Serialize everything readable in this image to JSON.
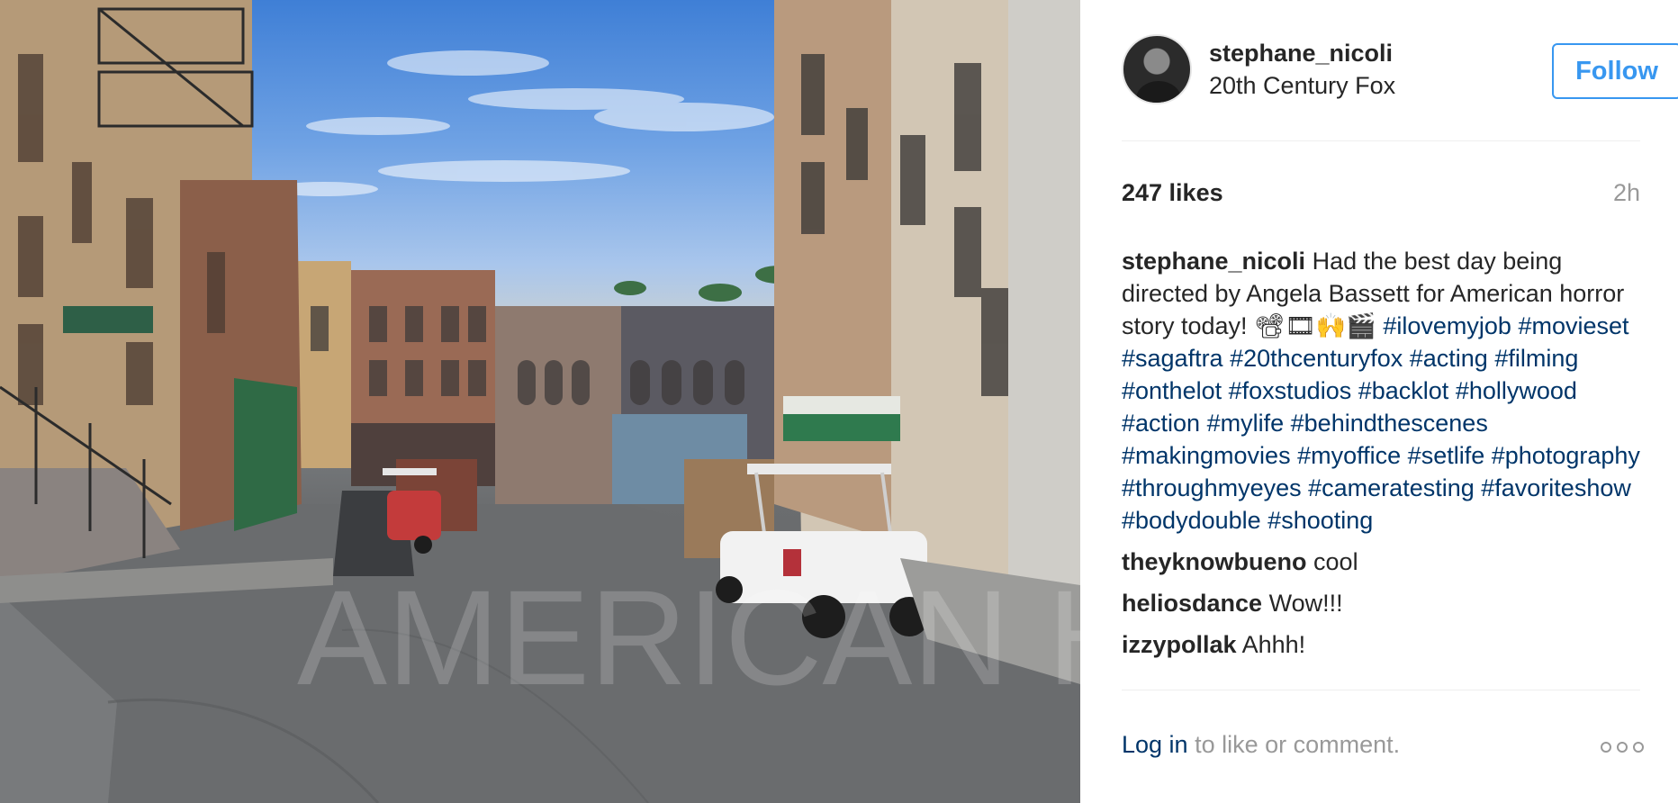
{
  "post": {
    "image_alt": "Empty studio backlot street with brick buildings, parked golf cart and dumpsters",
    "watermark": "AMERICAN HORROR STORY BRAS"
  },
  "header": {
    "username": "stephane_nicoli",
    "location": "20th Century Fox",
    "follow_label": "Follow"
  },
  "stats": {
    "likes": "247 likes",
    "time": "2h"
  },
  "caption": {
    "author": "stephane_nicoli",
    "text": "Had the best day being directed by Angela Bassett for American horror story today! 📽🎞🙌🎬",
    "hashtags": [
      "#ilovemyjob",
      "#movieset",
      "#sagaftra",
      "#20thcenturyfox",
      "#acting",
      "#filming",
      "#onthelot",
      "#foxstudios",
      "#backlot",
      "#hollywood",
      "#action",
      "#mylife",
      "#behindthescenes",
      "#makingmovies",
      "#myoffice",
      "#setlife",
      "#photography",
      "#throughmyeyes",
      "#cameratesting",
      "#favoriteshow",
      "#bodydouble",
      "#shooting"
    ]
  },
  "comments": [
    {
      "author": "theyknowbueno",
      "text": "cool"
    },
    {
      "author": "heliosdance",
      "text": "Wow!!!"
    },
    {
      "author": "izzypollak",
      "text": "Ahhh!"
    }
  ],
  "footer": {
    "login_link": "Log in",
    "login_text": " to like or comment."
  },
  "colors": {
    "link_blue": "#003569",
    "follow_blue": "#3897f0",
    "muted": "#999999"
  },
  "icons": {
    "more": "more-options-icon"
  }
}
